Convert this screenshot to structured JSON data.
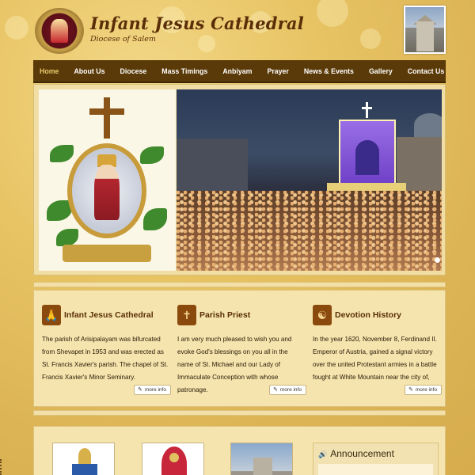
{
  "header": {
    "title": "Infant Jesus Cathedral",
    "subtitle": "Diocese of Salem"
  },
  "nav": {
    "items": [
      "Home",
      "About Us",
      "Diocese",
      "Mass Timings",
      "Anbiyam",
      "Prayer",
      "News & Events",
      "Gallery",
      "Contact Us"
    ],
    "active": "Home"
  },
  "slider": {
    "dot_count": 5,
    "active_dot": 1
  },
  "cards": [
    {
      "icon": "praying-hands-icon",
      "title": "Infant Jesus Cathedral",
      "text": "The parish of Arisipalayam was bifurcated from Shevapet in 1953 and was erected as St. Francis Xavier's parish. The chapel of St. Francis Xavier's Minor Seminary.",
      "button": "more info"
    },
    {
      "icon": "cross-icon",
      "title": "Parish Priest",
      "text": "I am very much pleased to wish you and evoke God's blessings on you all in the name of St. Michael and our Lady of Immaculate Conception with whose patronage.",
      "button": "more info"
    },
    {
      "icon": "yin-yang-icon",
      "title": "Devotion History",
      "text": "In the year 1620, November 8, Ferdinand II. Emperor of Austria, gained a signal victory over the united Protestant armies in a battle fought at White Mountain near the city of,",
      "button": "more info"
    }
  ],
  "bottom": {
    "announcement_title": "Announcement"
  },
  "colors": {
    "nav_bg": "#5a3a08",
    "accent_brown": "#8a4a0e",
    "panel_bg": "#f5e4ad",
    "title_color": "#5a2e08"
  }
}
